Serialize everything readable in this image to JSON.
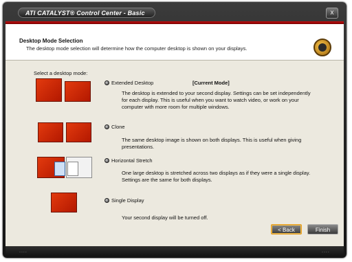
{
  "window": {
    "title": "ATI CATALYST® Control Center - Basic",
    "close_label": "x"
  },
  "header": {
    "title": "Desktop Mode Selection",
    "description": "The desktop mode selection will determine how the computer desktop is shown on your displays.",
    "logo_icon": "catalyst-logo-icon"
  },
  "select_label": "Select a desktop mode:",
  "options": [
    {
      "label": "Extended Desktop",
      "tag": "[Current Mode]",
      "selected": true,
      "description": [
        "The desktop is extended to your second display. Settings can be set independently",
        "for each display. This is useful when you want to watch video, or work on your",
        "computer with more room for multiple windows."
      ]
    },
    {
      "label": "Clone",
      "selected": false,
      "description": [
        "The same desktop image is shown on both displays. This is useful when giving",
        "presentations."
      ]
    },
    {
      "label": "Horizontal Stretch",
      "selected": false,
      "description": [
        "One large desktop is stretched across two displays as if they were a single display.",
        "Settings are the same for both displays."
      ]
    },
    {
      "label": "Single Display",
      "selected": false,
      "description": [
        "Your second display will be turned off."
      ]
    }
  ],
  "buttons": {
    "back": "< Back",
    "finish": "Finish"
  },
  "colors": {
    "accent_red": "#c01010",
    "thumbnail_orange": "#e23a0e",
    "focus_orange": "#e59a1e"
  }
}
